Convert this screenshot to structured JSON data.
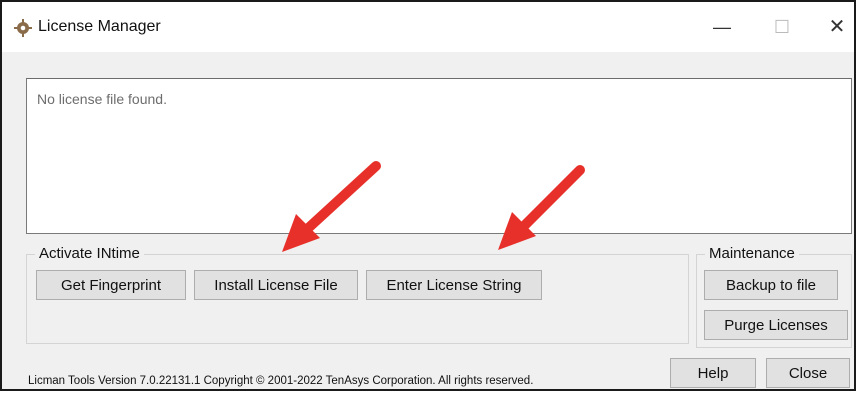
{
  "window": {
    "title": "License Manager",
    "icon": "gear-icon",
    "controls": {
      "minimize": "—",
      "maximize": "☐",
      "close": "✕"
    }
  },
  "log": {
    "text": "No license file found."
  },
  "activate": {
    "label": "Activate INtime",
    "buttons": {
      "fingerprint": "Get Fingerprint",
      "install_file": "Install License File",
      "enter_string": "Enter License String"
    }
  },
  "maintenance": {
    "label": "Maintenance",
    "buttons": {
      "backup": "Backup to file",
      "purge": "Purge Licenses"
    }
  },
  "footer": {
    "version_text": "Licman Tools Version 7.0.22131.1 Copyright © 2001-2022 TenAsys Corporation. All rights reserved.",
    "help": "Help",
    "close": "Close"
  },
  "colors": {
    "annotation_arrow": "#e8302a",
    "button_bg": "#e1e1e1",
    "window_bg": "#f0f0f0"
  }
}
